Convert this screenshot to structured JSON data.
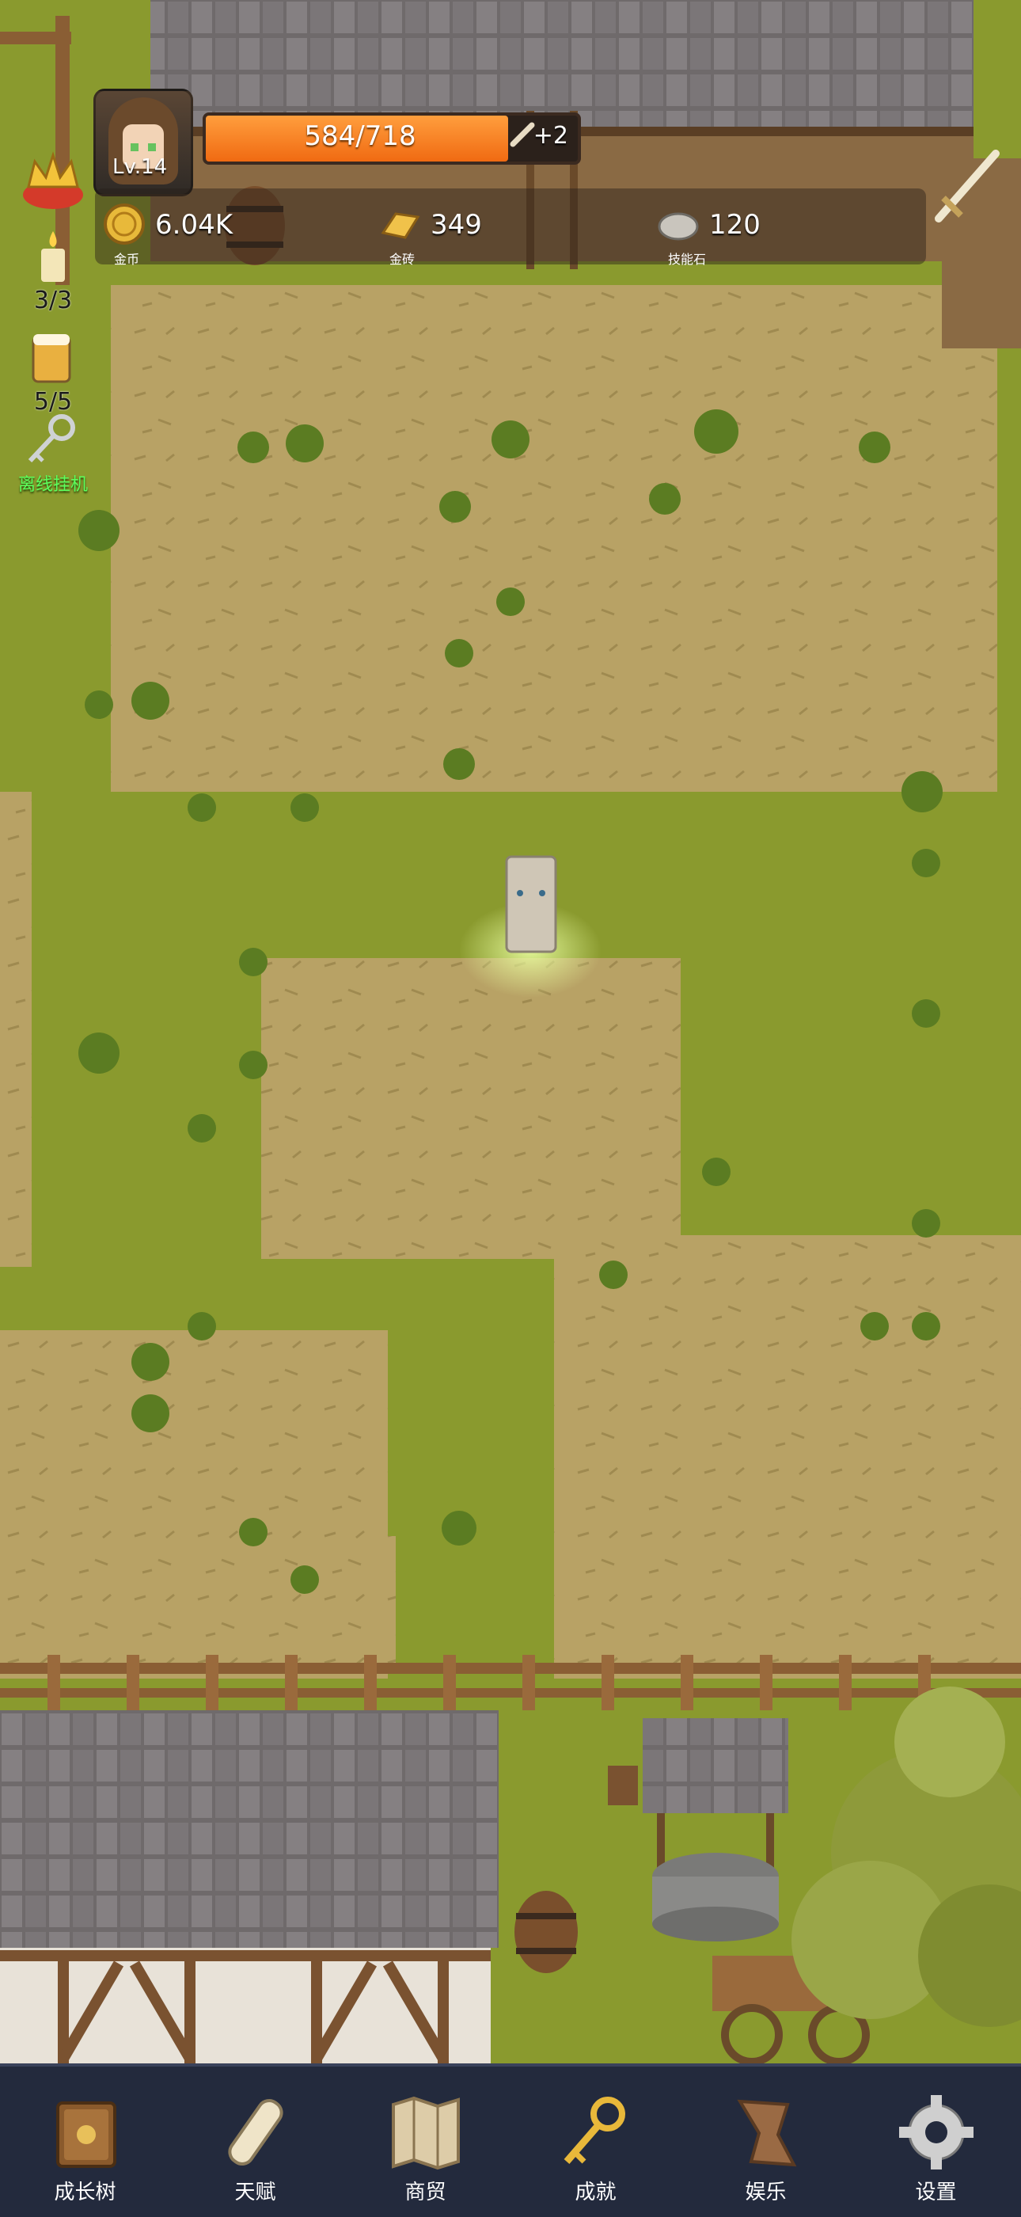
{
  "player": {
    "level": "Lv.14",
    "hp": "584/718",
    "hp_fraction": 0.813,
    "bonus": "+2"
  },
  "resources": [
    {
      "value": "6.04K",
      "label": "金币",
      "icon": "gold-coin-icon"
    },
    {
      "value": "349",
      "label": "金砖",
      "icon": "gold-brick-icon"
    },
    {
      "value": "120",
      "label": "技能石",
      "icon": "skill-stone-icon"
    }
  ],
  "side": {
    "candle_count": "3/3",
    "beer_count": "5/5",
    "idle_label": "离线挂机"
  },
  "nav": [
    {
      "label": "成长树",
      "icon": "book-icon"
    },
    {
      "label": "天赋",
      "icon": "scroll-icon"
    },
    {
      "label": "商贸",
      "icon": "map-icon"
    },
    {
      "label": "成就",
      "icon": "key-icon"
    },
    {
      "label": "娱乐",
      "icon": "parchment-icon"
    },
    {
      "label": "设置",
      "icon": "gear-icon"
    }
  ],
  "colors": {
    "grass": "#8a9a2e",
    "dirt": "#b9a366",
    "hp_fill": "#f07a1c",
    "nav_bg": "#232a3d"
  }
}
